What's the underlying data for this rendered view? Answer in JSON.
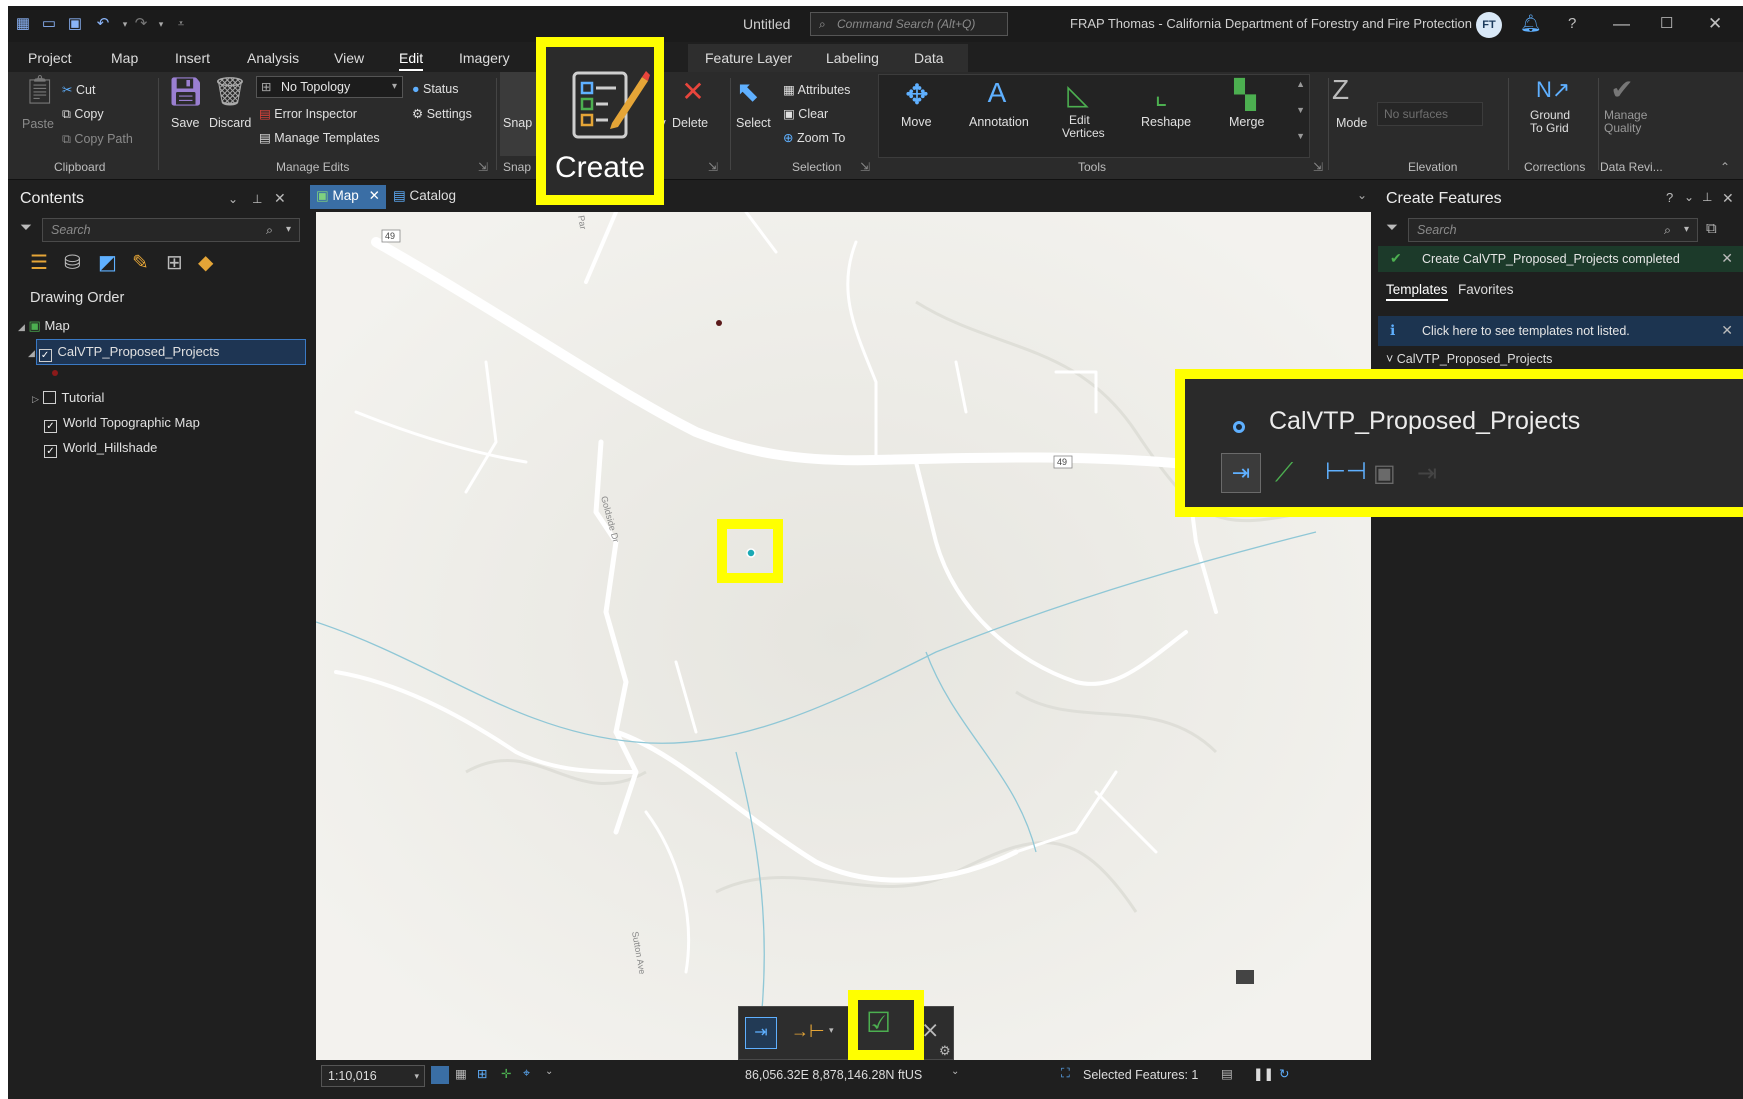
{
  "title_bar": {
    "document_title": "Untitled",
    "command_search_placeholder": "Command Search (Alt+Q)",
    "org_title": "FRAP Thomas - California Department of Forestry and Fire Protection",
    "avatar_initials": "FT"
  },
  "ribbon_tabs": [
    "Project",
    "Map",
    "Insert",
    "Analysis",
    "View",
    "Edit",
    "Imagery"
  ],
  "active_ribbon_tab": "Edit",
  "context_tabs": [
    "Feature Layer",
    "Labeling",
    "Data"
  ],
  "ribbon": {
    "clipboard": {
      "paste": "Paste",
      "cut": "Cut",
      "copy": "Copy",
      "copy_path": "Copy Path",
      "group": "Clipboard"
    },
    "manage_edits": {
      "save": "Save",
      "discard": "Discard",
      "topology": "No Topology",
      "error_inspector": "Error Inspector",
      "manage_templates": "Manage Templates",
      "status": "Status",
      "settings": "Settings",
      "group": "Manage Edits"
    },
    "snapping": {
      "snap": "Snap",
      "group": "Snap"
    },
    "features": {
      "create": "Create",
      "modify_fragment": "fy",
      "delete": "Delete",
      "group_fragment": "s"
    },
    "selection": {
      "select": "Select",
      "attributes": "Attributes",
      "clear": "Clear",
      "zoom_to": "Zoom To",
      "group": "Selection"
    },
    "tools": {
      "move": "Move",
      "annotation": "Annotation",
      "edit_vertices_1": "Edit",
      "edit_vertices_2": "Vertices",
      "reshape": "Reshape",
      "merge": "Merge",
      "group": "Tools"
    },
    "elevation": {
      "mode": "Mode",
      "surface_placeholder": "No surfaces",
      "group": "Elevation"
    },
    "corrections": {
      "ground_1": "Ground",
      "ground_2": "To Grid",
      "group": "Corrections"
    },
    "data_reviewer": {
      "manage_1": "Manage",
      "manage_2": "Quality",
      "group": "Data Revi..."
    }
  },
  "contents": {
    "title": "Contents",
    "search_placeholder": "Search",
    "drawing_order": "Drawing Order",
    "layers": [
      {
        "name": "Map",
        "checked": true
      },
      {
        "name": "CalVTP_Proposed_Projects",
        "checked": true,
        "selected": true
      },
      {
        "name": "Tutorial",
        "checked": false
      },
      {
        "name": "World Topographic Map",
        "checked": true
      },
      {
        "name": "World_Hillshade",
        "checked": true
      }
    ]
  },
  "map_view": {
    "tabs": [
      "Map",
      "Catalog"
    ],
    "active_tab": "Map",
    "road_labels": [
      "49",
      "49",
      "Goldside Dr",
      "Par",
      "Sutton Ave"
    ],
    "scale": "1:10,016",
    "coordinates": "86,056.32E 8,878,146.28N ftUS",
    "selected_features": "Selected Features: 1"
  },
  "create_features": {
    "title": "Create Features",
    "search_placeholder": "Search",
    "success_message": "Create CalVTP_Proposed_Projects completed",
    "tabs": [
      "Templates",
      "Favorites"
    ],
    "active_tab": "Templates",
    "info_message": "Click here to see templates not listed.",
    "group_header": "CalVTP_Proposed_Projects",
    "template_name": "CalVTP_Proposed_Projects"
  },
  "colors": {
    "highlight": "#ffff00",
    "accent_blue": "#5fb0ff",
    "point_feature": "#1aa9b4"
  }
}
